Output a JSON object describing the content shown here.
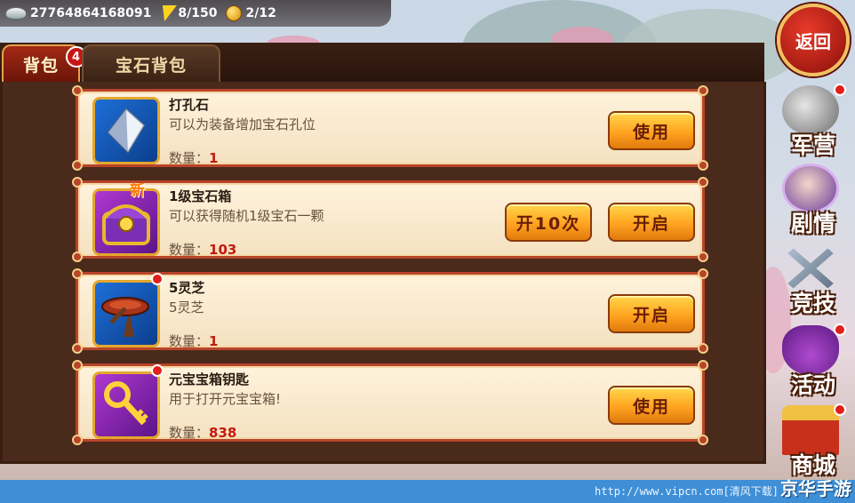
{
  "resources": {
    "silver": "277648641680​91",
    "energy": "8/150",
    "gold_ingot": "2/12"
  },
  "tabs": [
    {
      "label": "背包",
      "badge": "4"
    },
    {
      "label": "宝石背包"
    }
  ],
  "items": [
    {
      "name": "打孔石",
      "desc": "可以为装备增加宝石孔位",
      "qty_label": "数量：",
      "qty": "1",
      "icon": "crystal-icon",
      "buttons": [
        "使用"
      ]
    },
    {
      "name": "1级宝石箱",
      "desc": "可以获得随机1级宝石一颗",
      "qty_label": "数量：",
      "qty": "103",
      "icon": "treasure-chest-icon",
      "new_tag": "新",
      "buttons": [
        "开启",
        "开10次"
      ]
    },
    {
      "name": "5灵芝",
      "desc": "5灵芝",
      "qty_label": "数量：",
      "qty": "1",
      "icon": "lingzhi-mushroom-icon",
      "buttons": [
        "开启"
      ]
    },
    {
      "name": "元宝宝箱钥匙",
      "desc": "用于打开元宝宝箱!",
      "qty_label": "数量：",
      "qty": "838",
      "icon": "golden-key-icon",
      "buttons": [
        "使用"
      ]
    }
  ],
  "sidebar": {
    "back_label": "返回",
    "items": [
      {
        "label": "军营",
        "icon": "helmet-icon"
      },
      {
        "label": "剧情",
        "icon": "character-portrait-icon"
      },
      {
        "label": "竞技",
        "icon": "crossed-swords-icon"
      },
      {
        "label": "活动",
        "icon": "gift-bag-icon"
      },
      {
        "label": "商城",
        "icon": "shop-pavilion-icon"
      }
    ]
  },
  "footer": {
    "watermark": "http://www.vipcn.com[清风下载]",
    "logo": "京华手游"
  },
  "colors": {
    "item_border": "#b8442a",
    "button_gold": "#ffa320",
    "qty_red": "#c21a0e",
    "footer_blue": "#3f8fd6"
  }
}
